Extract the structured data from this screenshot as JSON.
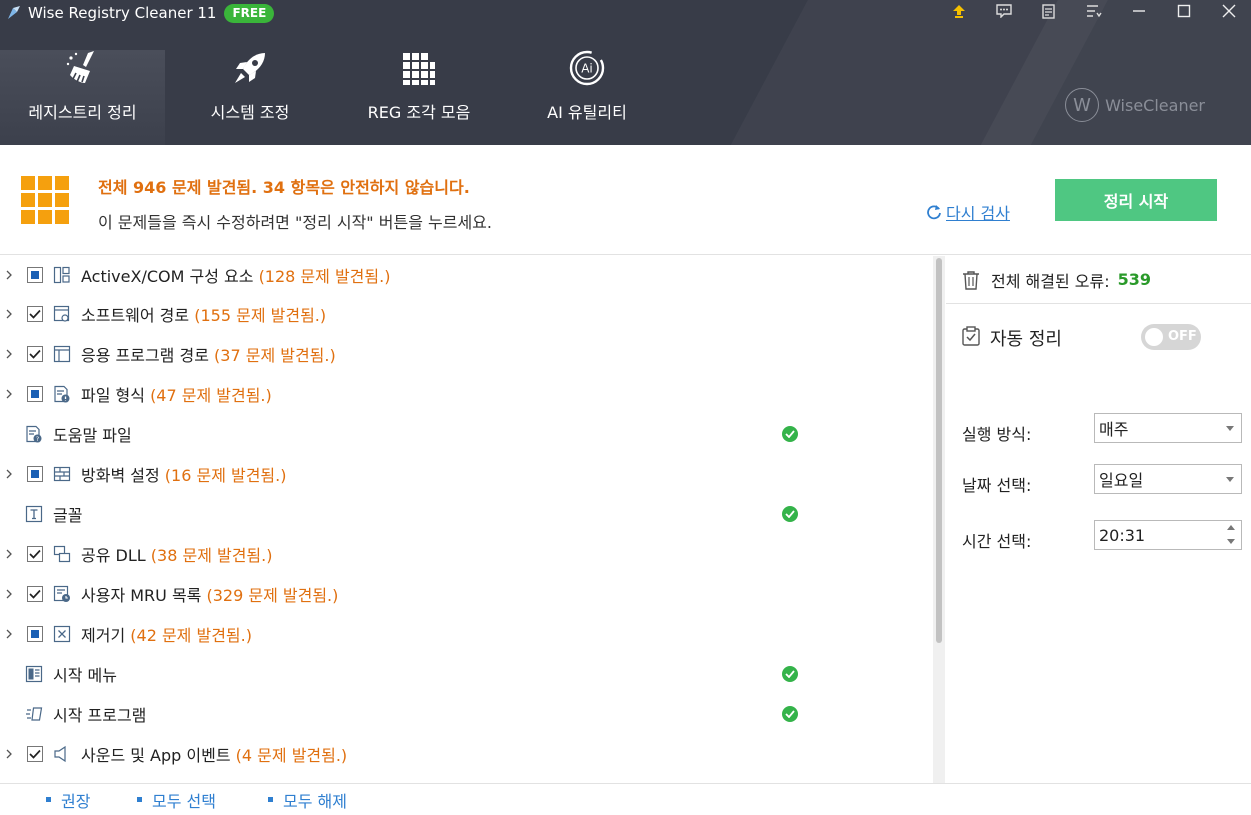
{
  "window": {
    "title": "Wise Registry Cleaner 11",
    "badge": "FREE",
    "controls": [
      "upgrade-icon",
      "feedback-icon",
      "notes-icon",
      "menu-icon",
      "minimize-icon",
      "maximize-icon",
      "close-icon"
    ]
  },
  "nav": {
    "tabs": [
      {
        "label": "레지스트리 정리",
        "icon": "broom-icon",
        "active": true
      },
      {
        "label": "시스템 조정",
        "icon": "rocket-icon",
        "active": false
      },
      {
        "label": "REG 조각 모음",
        "icon": "blocks-icon",
        "active": false
      },
      {
        "label": "AI 유틸리티",
        "icon": "ai-icon",
        "active": false
      }
    ],
    "brand": {
      "letter": "W",
      "name": "WiseCleaner"
    }
  },
  "summary": {
    "title": "전체 946 문제 발견됨. 34 항목은 안전하지 않습니다.",
    "subtitle": "이 문제들을 즉시 수정하려면 \"정리 시작\" 버튼을 누르세요.",
    "rescan_label": "다시 검사",
    "clean_button": "정리 시작"
  },
  "list": {
    "items": [
      {
        "label": "ActiveX/COM 구성 요소",
        "count": "(128 문제 발견됨.)",
        "expandable": true,
        "checkbox": "partial",
        "icon": "component-icon",
        "ok": false
      },
      {
        "label": "소프트웨어 경로",
        "count": "(155 문제 발견됨.)",
        "expandable": true,
        "checkbox": "checked",
        "icon": "software-path-icon",
        "ok": false
      },
      {
        "label": "응용 프로그램 경로",
        "count": "(37 문제 발견됨.)",
        "expandable": true,
        "checkbox": "checked",
        "icon": "app-path-icon",
        "ok": false
      },
      {
        "label": "파일 형식",
        "count": "(47 문제 발견됨.)",
        "expandable": true,
        "checkbox": "partial",
        "icon": "file-type-icon",
        "ok": false
      },
      {
        "label": "도움말 파일",
        "count": "",
        "expandable": false,
        "checkbox": "none",
        "icon": "help-file-icon",
        "ok": true
      },
      {
        "label": "방화벽 설정",
        "count": "(16 문제 발견됨.)",
        "expandable": true,
        "checkbox": "partial",
        "icon": "firewall-icon",
        "ok": false
      },
      {
        "label": "글꼴",
        "count": "",
        "expandable": false,
        "checkbox": "none",
        "icon": "font-icon",
        "ok": true
      },
      {
        "label": "공유 DLL",
        "count": "(38 문제 발견됨.)",
        "expandable": true,
        "checkbox": "checked",
        "icon": "shared-dll-icon",
        "ok": false
      },
      {
        "label": "사용자 MRU 목록",
        "count": "(329 문제 발견됨.)",
        "expandable": true,
        "checkbox": "checked",
        "icon": "mru-icon",
        "ok": false
      },
      {
        "label": "제거기",
        "count": "(42 문제 발견됨.)",
        "expandable": true,
        "checkbox": "partial",
        "icon": "uninstaller-icon",
        "ok": false
      },
      {
        "label": "시작 메뉴",
        "count": "",
        "expandable": false,
        "checkbox": "none",
        "icon": "start-menu-icon",
        "ok": true
      },
      {
        "label": "시작 프로그램",
        "count": "",
        "expandable": false,
        "checkbox": "none",
        "icon": "startup-icon",
        "ok": true
      },
      {
        "label": "사운드 및 App 이벤트",
        "count": "(4 문제 발견됨.)",
        "expandable": true,
        "checkbox": "checked",
        "icon": "sound-icon",
        "ok": false
      }
    ]
  },
  "right": {
    "fixed_label": "전체 해결된 오류:",
    "fixed_value": "539",
    "auto_clean_label": "자동 정리",
    "toggle_label": "OFF",
    "run_label": "실행 방식:",
    "run_value": "매주",
    "date_label": "날짜 선택:",
    "date_value": "일요일",
    "time_label": "시간 선택:",
    "time_value": "20:31"
  },
  "footer": {
    "recommend": "권장",
    "select_all": "모두 선택",
    "deselect_all": "모두 해제"
  },
  "colors": {
    "header_bg": "#383c48",
    "accent_orange": "#e07010",
    "clean_green": "#4fc782",
    "link_blue": "#2f7fd0",
    "ok_green": "#34b34a"
  }
}
